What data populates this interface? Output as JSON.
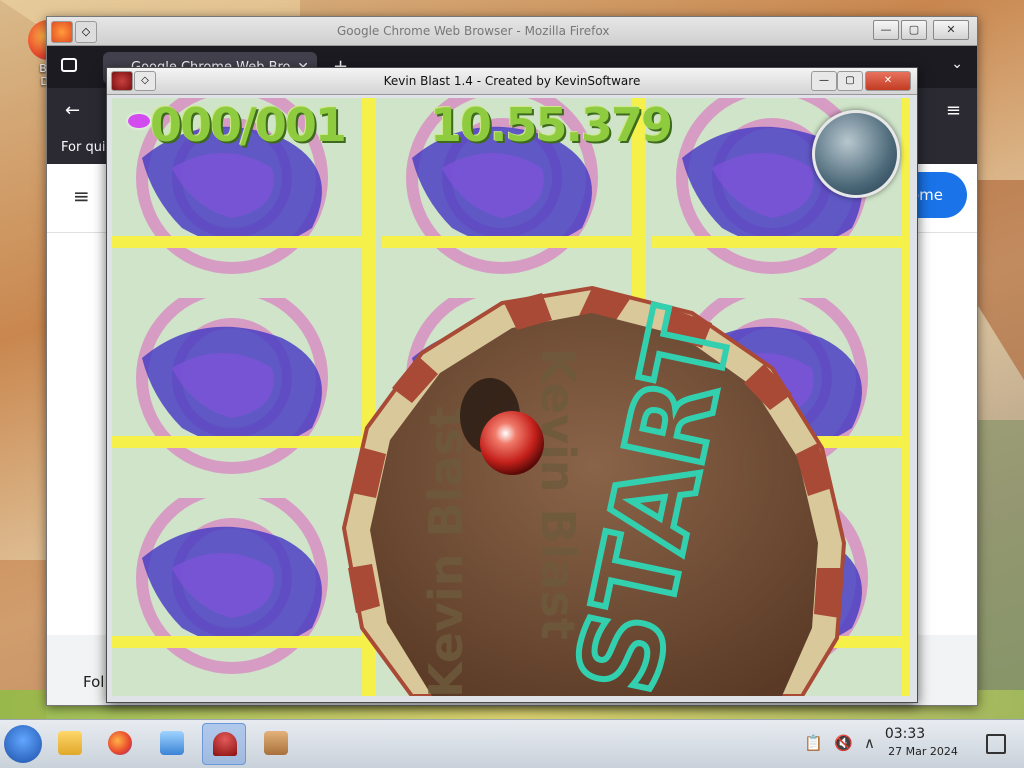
{
  "desktop": {
    "icons": [
      {
        "label": "Big\nDe",
        "icon": "firefox-desktop-icon"
      }
    ]
  },
  "firefox_window": {
    "title": "Google Chrome Web Browser - Mozilla Firefox",
    "tab_label": "Google Chrome Web Bro",
    "tab_close": "✕",
    "new_tab": "+",
    "list_tabs": "⌄",
    "back": "←",
    "menu": "≡",
    "info_text": "For qui",
    "page_hamburger": "≡",
    "blue_button_text": "ome",
    "follow_text": "Fol",
    "controls": {
      "minimize": "—",
      "maximize": "▢",
      "close": "✕"
    }
  },
  "game_window": {
    "title": "Kevin Blast 1.4 - Created by KevinSoftware",
    "controls": {
      "minimize": "—",
      "maximize": "▢",
      "close": "✕"
    },
    "hud": {
      "counter": "000/001",
      "timer": "10.55.379"
    },
    "scene_text": {
      "logo_left": "Kevin Blast",
      "logo_right": "Kevin Blast",
      "start": "START"
    }
  },
  "taskbar": {
    "apps": [
      {
        "name": "file-manager",
        "active": false
      },
      {
        "name": "firefox",
        "active": false
      },
      {
        "name": "system-settings",
        "active": false
      },
      {
        "name": "wine",
        "active": true
      },
      {
        "name": "package-installer",
        "active": false
      }
    ],
    "tray": {
      "clipboard": "📋",
      "volume_muted": "🔇",
      "expand": "∧"
    },
    "clock": {
      "time": "03:33",
      "date": "27 Mar 2024"
    }
  }
}
